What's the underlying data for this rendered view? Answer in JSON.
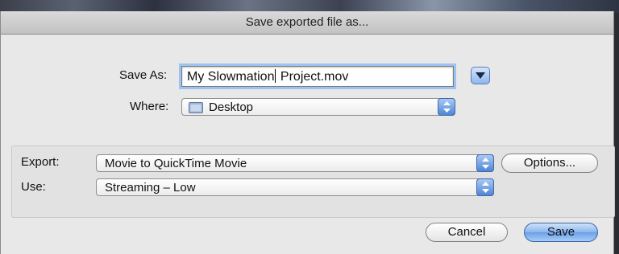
{
  "dialog": {
    "title": "Save exported file as..."
  },
  "save_as": {
    "label": "Save As:",
    "value_before_caret": "My Slowmation",
    "value_after_caret": " Project.mov"
  },
  "where": {
    "label": "Where:",
    "selected": "Desktop"
  },
  "export": {
    "label": "Export:",
    "selected": "Movie to QuickTime Movie",
    "options_label": "Options..."
  },
  "use": {
    "label": "Use:",
    "selected": "Streaming – Low"
  },
  "buttons": {
    "cancel": "Cancel",
    "save": "Save"
  },
  "icons": {
    "disclosure": "disclosure-triangle-icon",
    "folder": "folder-icon",
    "stepper": "popup-stepper-icon"
  },
  "colors": {
    "accent": "#6aa0e8",
    "focus_ring": "#9cc3f2"
  }
}
